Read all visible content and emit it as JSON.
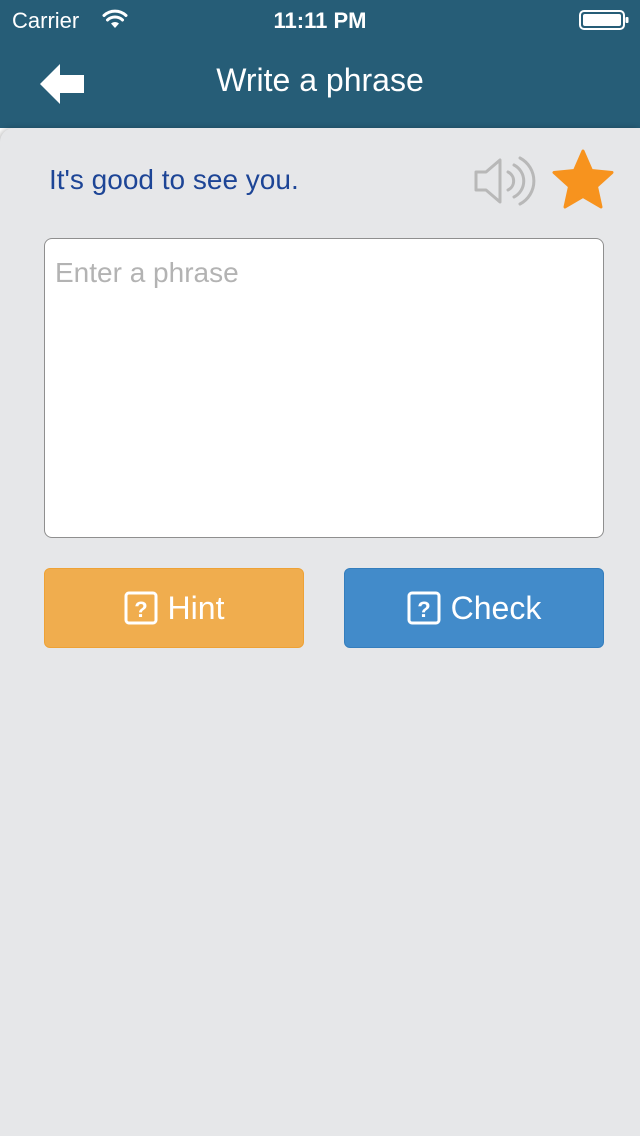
{
  "status_bar": {
    "carrier": "Carrier",
    "time": "11:11 PM",
    "wifi_icon": "wifi-icon",
    "battery_icon": "battery-full-icon"
  },
  "nav": {
    "back_icon": "arrow-left-icon",
    "title": "Write a phrase"
  },
  "phrase": {
    "text": "It's good to see you.",
    "speaker_icon": "speaker-icon",
    "favorite_icon": "star-icon"
  },
  "input": {
    "placeholder": "Enter a phrase",
    "value": ""
  },
  "buttons": {
    "hint_label": "Hint",
    "check_label": "Check",
    "hint_icon": "question-square-icon",
    "check_icon": "question-square-icon"
  },
  "colors": {
    "nav_background": "#265d77",
    "phrase_text": "#1d4596",
    "star": "#f7931e",
    "hint_button": "#f0ad4e",
    "check_button": "#428bca",
    "card_background": "#e6e7e9"
  }
}
